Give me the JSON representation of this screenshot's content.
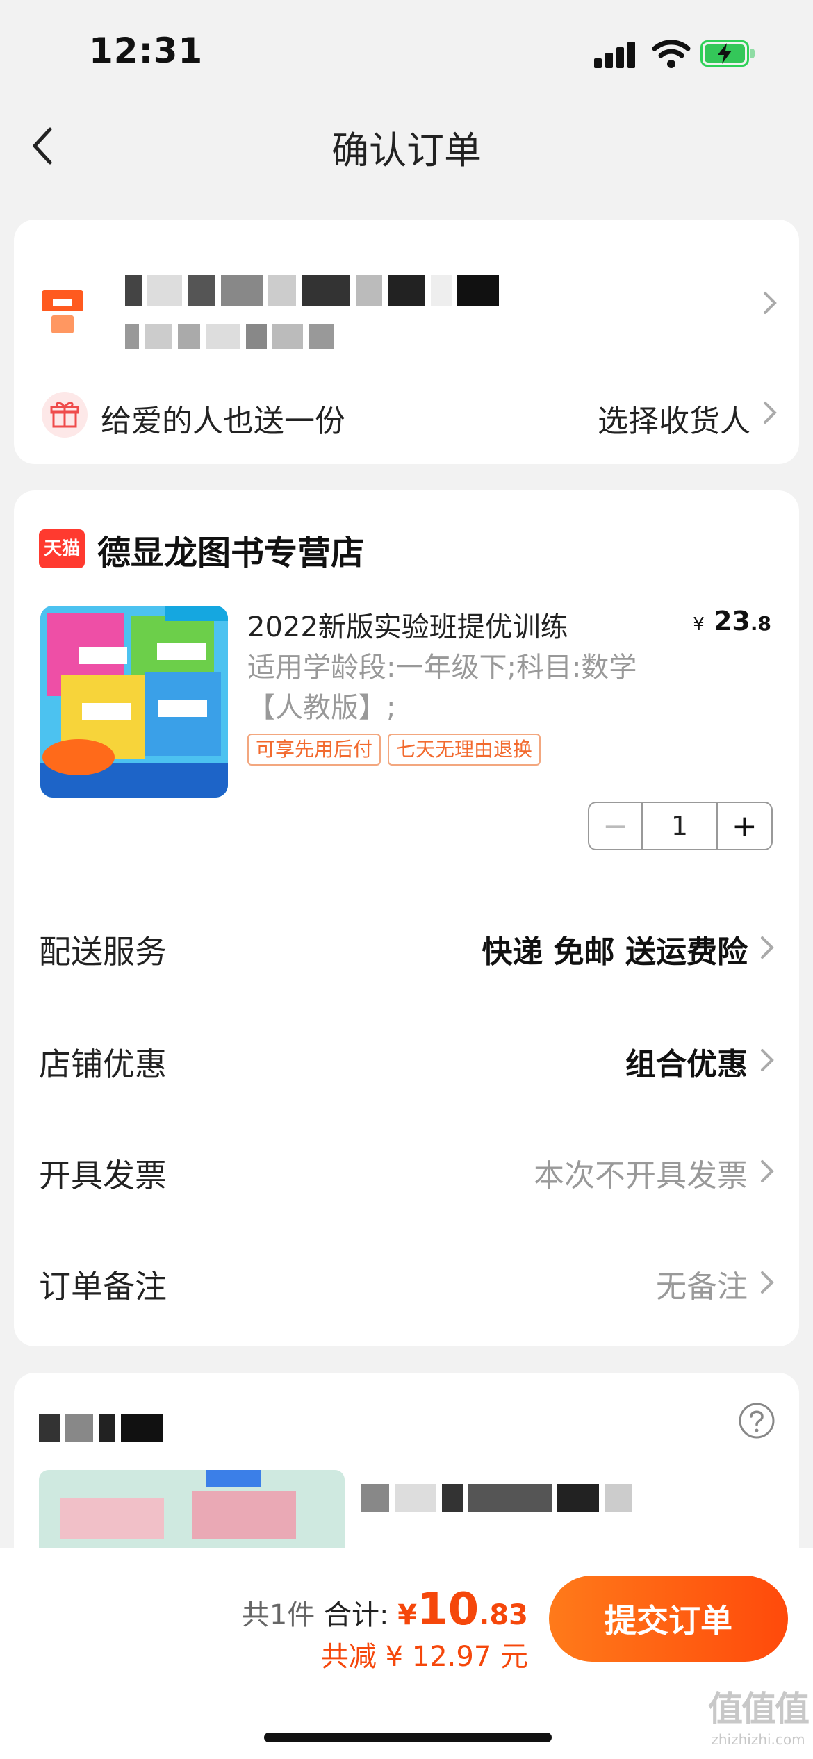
{
  "status_bar": {
    "time": "12:31"
  },
  "nav": {
    "title": "确认订单"
  },
  "address": {
    "gift_text": "给爱的人也送一份",
    "choose_receiver": "选择收货人"
  },
  "order": {
    "store_badge": "天猫",
    "store_name": "德显龙图书专营店",
    "product": {
      "title": "2022新版实验班提优训练",
      "spec": "适用学龄段:一年级下;科目:数学【人教版】;",
      "price_currency": "¥",
      "price_int": "23",
      "price_dec": ".8",
      "tags": [
        "可享先用后付",
        "七天无理由退换"
      ],
      "quantity": "1",
      "minus_symbol": "−",
      "plus_symbol": "+"
    },
    "rows": [
      {
        "label": "配送服务",
        "value": "快递 免邮 送运费险"
      },
      {
        "label": "店铺优惠",
        "value": "组合优惠"
      },
      {
        "label": "开具发票",
        "value": "本次不开具发票"
      },
      {
        "label": "订单备注",
        "value": "无备注"
      }
    ]
  },
  "bottom": {
    "count_text": "共1件",
    "total_label": "合计:",
    "total_currency": "¥",
    "total_int": "10",
    "total_dec": ".83",
    "discount_text": "共减 ¥ 12.97 元",
    "submit_label": "提交订单"
  },
  "watermark": {
    "logo": "值值值",
    "url": "zhizhizhi.com"
  },
  "colors": {
    "accent": "#f5470b",
    "submit_gradient_start": "#ff7a1a",
    "tag_border": "#f3a77f",
    "tmall_red": "#ff3a2f"
  }
}
